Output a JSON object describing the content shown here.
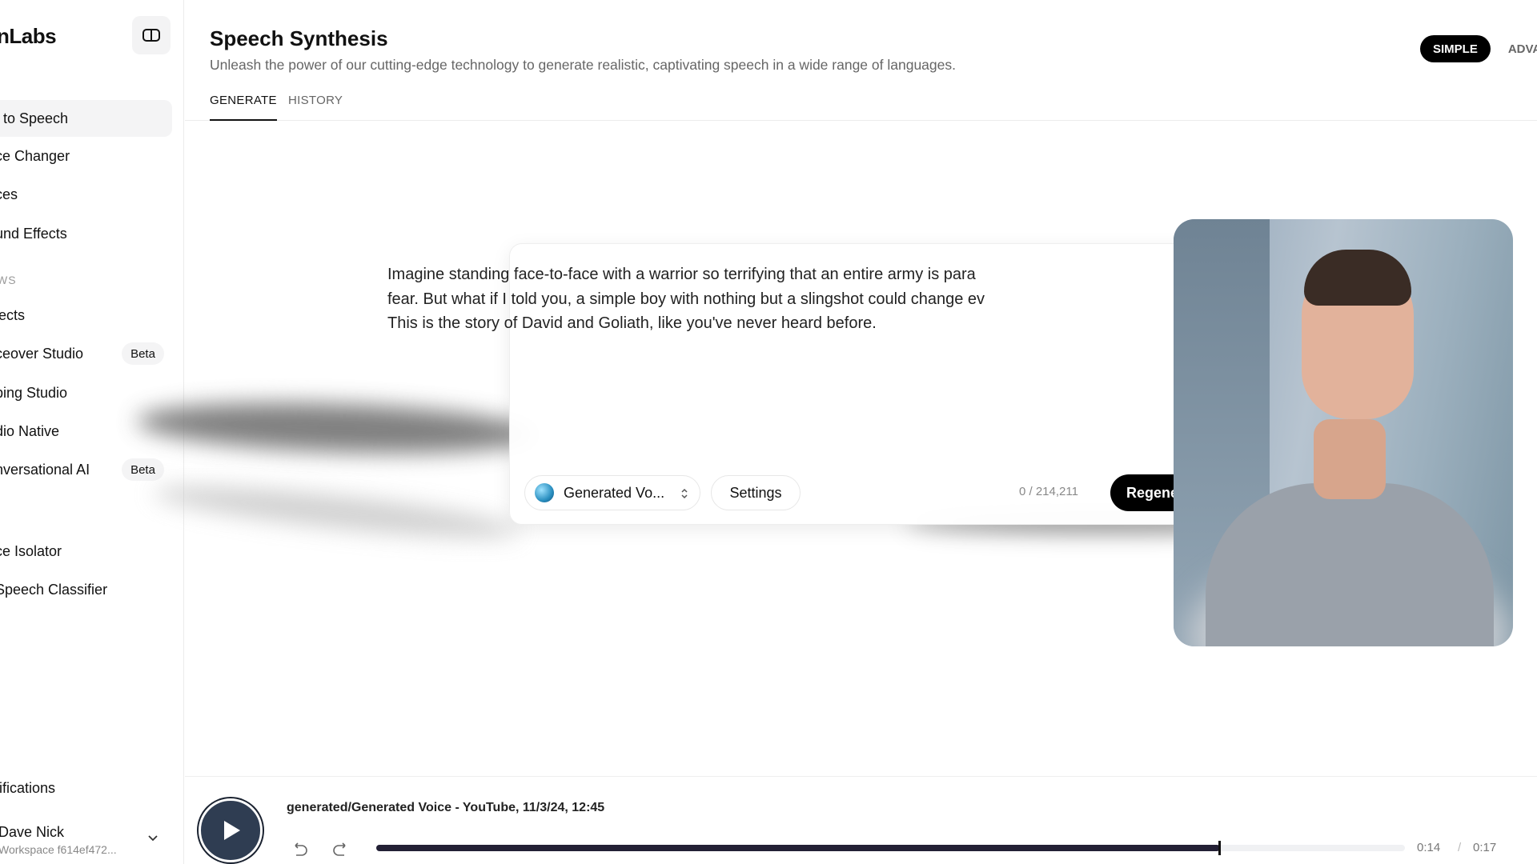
{
  "sidebar": {
    "logo": "nLabs",
    "items": [
      {
        "label": "t to Speech",
        "active": true
      },
      {
        "label": "ce Changer"
      },
      {
        "label": "ces"
      },
      {
        "label": "und Effects"
      }
    ],
    "section_label": "WS",
    "workflow_items": [
      {
        "label": "jects"
      },
      {
        "label": "ceover Studio",
        "badge": "Beta"
      },
      {
        "label": "bing Studio"
      },
      {
        "label": "dio Native"
      },
      {
        "label": "nversational AI",
        "badge": "Beta"
      }
    ],
    "tool_items": [
      {
        "label": "ce Isolator"
      },
      {
        "label": "Speech Classifier"
      }
    ],
    "notifications": "tifications",
    "user": {
      "name": "Dave Nick",
      "workspace": "Workspace f614ef472..."
    }
  },
  "header": {
    "title": "Speech Synthesis",
    "subtitle": "Unleash the power of our cutting-edge technology to generate realistic, captivating speech in a wide range of languages.",
    "tabs": [
      {
        "label": "GENERATE",
        "active": true
      },
      {
        "label": "HISTORY"
      }
    ],
    "mode": {
      "simple": "SIMPLE",
      "advanced": "ADVA"
    }
  },
  "editor": {
    "lines": [
      "Imagine standing face-to-face with a warrior so terrifying that an entire army is para",
      "fear. But what if I told you, a simple boy with nothing but a slingshot could change ev",
      "This is the story of David and Goliath, like you've never heard before."
    ],
    "voice": "Generated Vo...",
    "settings": "Settings",
    "char_count": "0 / 214,211",
    "regenerate": "Regene"
  },
  "player": {
    "title": "generated/Generated Voice - YouTube, 11/3/24, 12:45",
    "current": "0:14",
    "separator": "/",
    "duration": "0:17",
    "progress": 0.82
  }
}
